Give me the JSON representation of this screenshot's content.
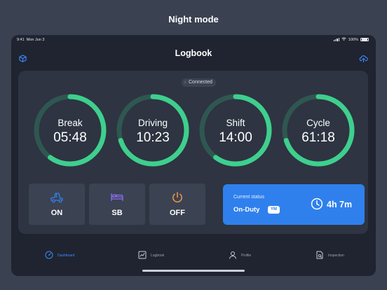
{
  "banner": "Night mode",
  "status_bar": {
    "time": "9:41",
    "date": "Mon Jun 3",
    "battery": "100%"
  },
  "header": {
    "title": "Logbook",
    "left_icon": "cube-icon",
    "right_icon": "cloud-upload-icon"
  },
  "connection": {
    "label": "Connected",
    "icon": "bluetooth-icon"
  },
  "colors": {
    "accent": "#2f80ed",
    "gauge_fill": "#3ecf8e",
    "gauge_track": "#2f5751",
    "panel": "#2e3441",
    "tile": "#3b4251"
  },
  "gauges": [
    {
      "label": "Break",
      "value": "05:48",
      "fraction": 0.6
    },
    {
      "label": "Driving",
      "value": "10:23",
      "fraction": 0.7
    },
    {
      "label": "Shift",
      "value": "14:00",
      "fraction": 0.6
    },
    {
      "label": "Cycle",
      "value": "61:18",
      "fraction": 0.7
    }
  ],
  "duty_buttons": [
    {
      "label": "ON",
      "icon": "truck-icon",
      "icon_color": "#2f80ed"
    },
    {
      "label": "SB",
      "icon": "bed-icon",
      "icon_color": "#8b6cf6"
    },
    {
      "label": "OFF",
      "icon": "power-icon",
      "icon_color": "#f2994a"
    }
  ],
  "current_status": {
    "caption": "Current status",
    "status": "On-Duty",
    "badge": "YM",
    "duration": "4h 7m",
    "icon": "clock-icon"
  },
  "tabs": [
    {
      "label": "Dashboard",
      "icon": "dashboard-icon",
      "active": true
    },
    {
      "label": "Logbook",
      "icon": "logbook-icon",
      "active": false
    },
    {
      "label": "Profile",
      "icon": "profile-icon",
      "active": false
    },
    {
      "label": "Inspection",
      "icon": "inspection-icon",
      "active": false
    }
  ]
}
